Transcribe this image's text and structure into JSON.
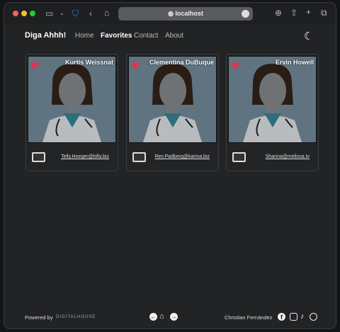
{
  "browser": {
    "url": "localhost"
  },
  "nav": {
    "brand": "Diga Ahhh!",
    "links": [
      "Home",
      "Favorites",
      "Contact",
      "About"
    ],
    "active": "Favorites",
    "theme_icon": "moon-stars-icon"
  },
  "cards": [
    {
      "name": "Kurtis Weissnat",
      "email": "Telly.Hoeger@billy.biz"
    },
    {
      "name": "Clementina DuBuque",
      "email": "Rev.Padberg@karina.biz"
    },
    {
      "name": "Ervin Howell",
      "email": "Shanna@melissa.tv"
    }
  ],
  "footer": {
    "powered": "Powered by",
    "brand": "DIGITALHOUSE",
    "author": "Christian Fernández"
  },
  "colors": {
    "heart": "#e8304f",
    "card_image_bg": "#5f7480"
  }
}
